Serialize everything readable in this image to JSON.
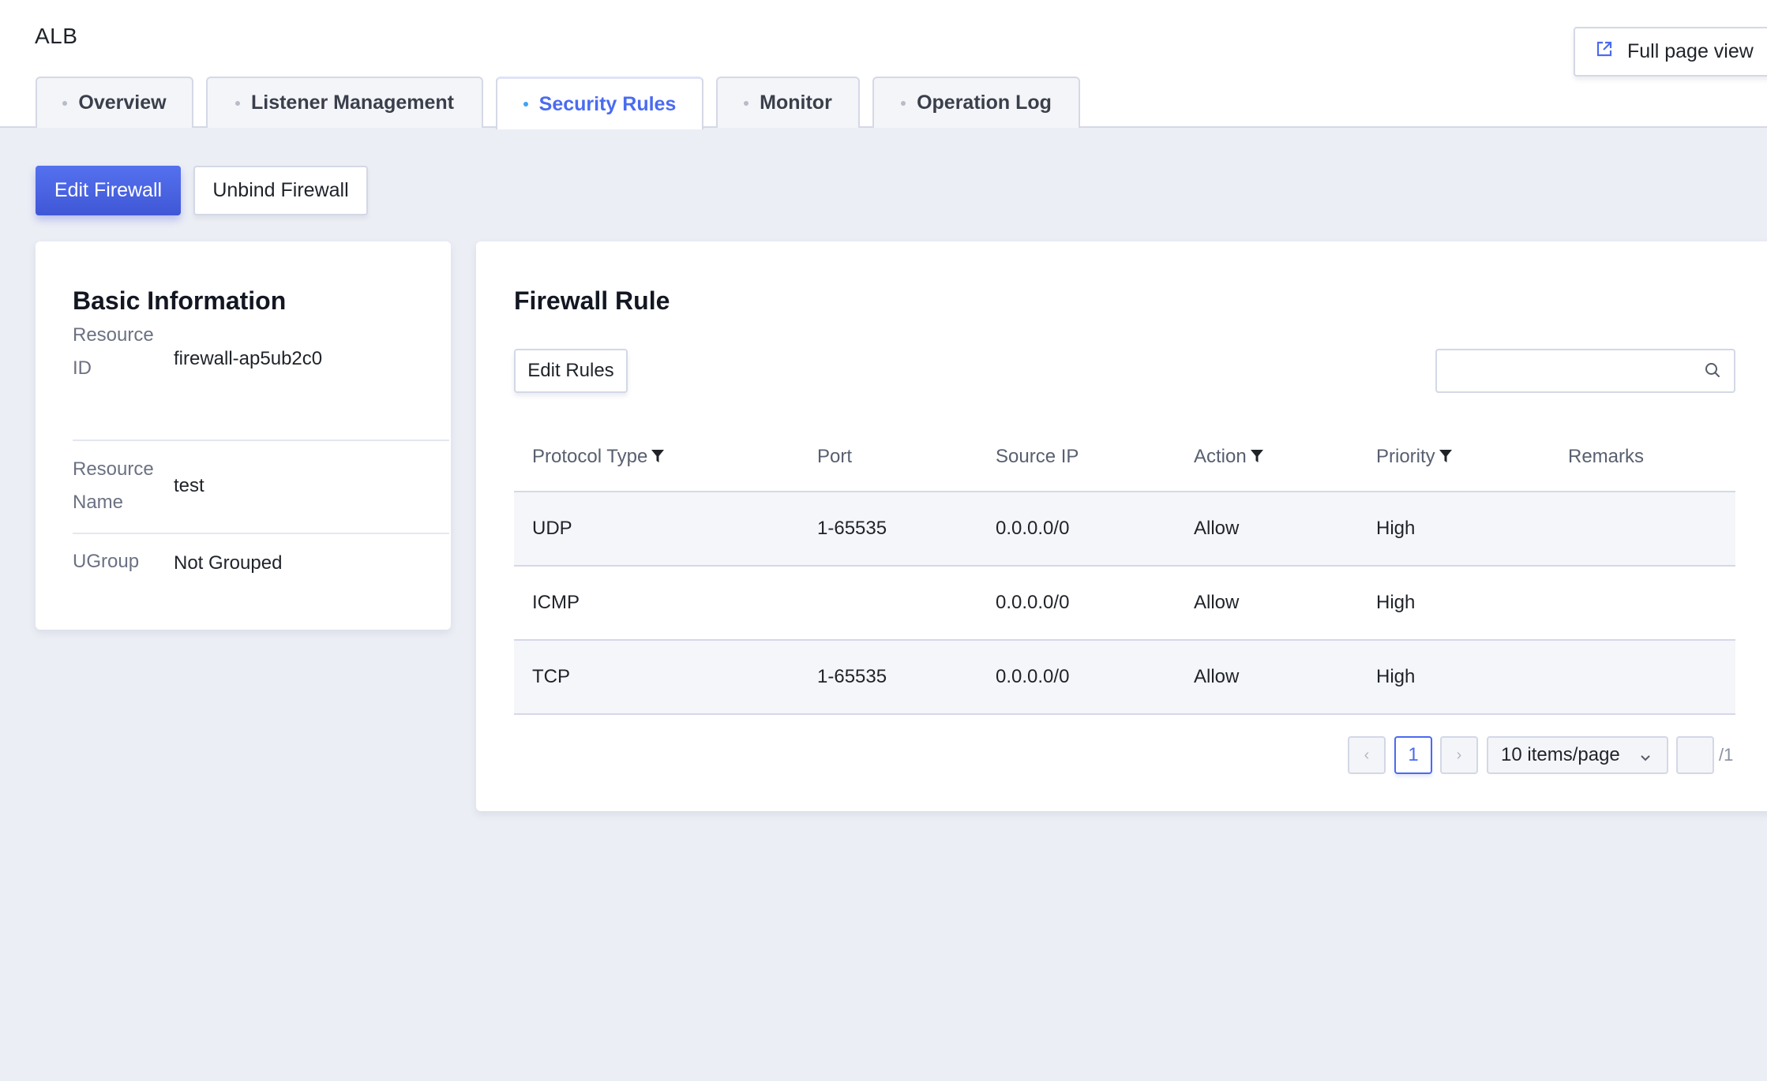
{
  "app": {
    "title": "ALB",
    "full_page_label": "Full page view"
  },
  "tabs": [
    {
      "label": "Overview"
    },
    {
      "label": "Listener Management"
    },
    {
      "label": "Security Rules"
    },
    {
      "label": "Monitor"
    },
    {
      "label": "Operation Log"
    }
  ],
  "active_tab": "Security Rules",
  "toolbar": {
    "edit_firewall": "Edit Firewall",
    "unbind_firewall": "Unbind Firewall"
  },
  "basic_info": {
    "title": "Basic Information",
    "rows": [
      {
        "label": "Resource ID",
        "value": "firewall-ap5ub2c0"
      },
      {
        "label": "Resource Name",
        "value": "test"
      },
      {
        "label": "UGroup",
        "value": "Not Grouped"
      }
    ]
  },
  "firewall_rule": {
    "title": "Firewall Rule",
    "edit_rules": "Edit Rules",
    "search_placeholder": "",
    "columns": [
      "Protocol Type",
      "Port",
      "Source IP",
      "Action",
      "Priority",
      "Remarks"
    ],
    "rows": [
      [
        "UDP",
        "1-65535",
        "0.0.0.0/0",
        "Allow",
        "High",
        ""
      ],
      [
        "ICMP",
        "",
        "0.0.0.0/0",
        "Allow",
        "High",
        ""
      ],
      [
        "TCP",
        "1-65535",
        "0.0.0.0/0",
        "Allow",
        "High",
        ""
      ]
    ]
  },
  "pagination": {
    "prev": "‹",
    "next": "›",
    "current_page": "1",
    "page_size": "10 items/page",
    "total": "/1"
  },
  "colors": {
    "accent": "#4a6bf0",
    "background": "#eceef5"
  },
  "icons": {
    "full_page": "external-link-icon",
    "search": "search-icon",
    "filter": "filter-icon",
    "dropdown": "chevron-down-icon"
  }
}
